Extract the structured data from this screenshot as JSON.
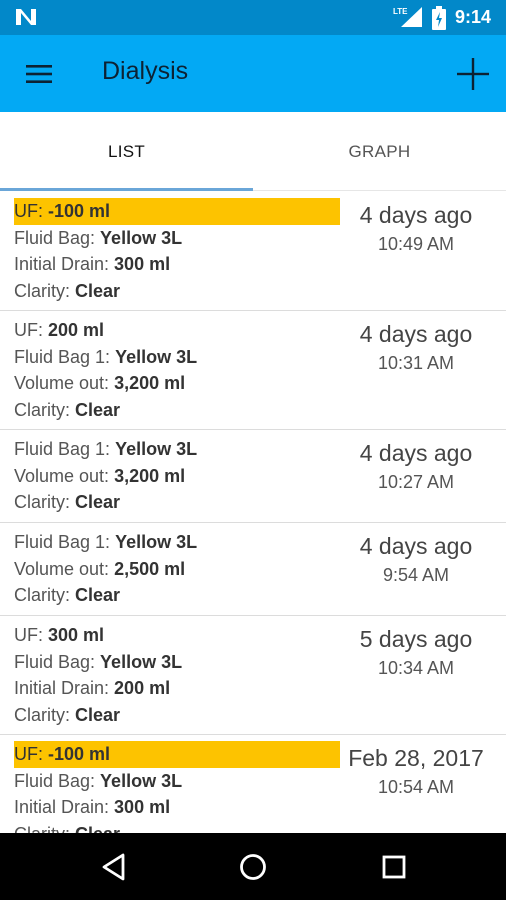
{
  "status_bar": {
    "time": "9:14",
    "network": "LTE",
    "icons": [
      "n-logo-icon",
      "lte-signal-icon",
      "battery-icon"
    ]
  },
  "app_bar": {
    "title": "Dialysis",
    "menu_icon": "hamburger-menu-icon",
    "add_icon": "plus-icon",
    "color": "#03a9f4"
  },
  "tabs": [
    {
      "label": "LIST",
      "selected": true
    },
    {
      "label": "GRAPH",
      "selected": false
    }
  ],
  "highlight_color": "#fdc300",
  "entries": [
    {
      "lines": [
        {
          "label": "UF: ",
          "value": "-100 ml",
          "highlight": true
        },
        {
          "label": "Fluid Bag: ",
          "value": "Yellow 3L",
          "highlight": false
        },
        {
          "label": "Initial Drain: ",
          "value": "300 ml",
          "highlight": false
        },
        {
          "label": "Clarity: ",
          "value": "Clear",
          "highlight": false
        }
      ],
      "day": "4 days ago",
      "time": "10:49 AM"
    },
    {
      "lines": [
        {
          "label": "UF: ",
          "value": "200 ml",
          "highlight": false
        },
        {
          "label": "Fluid Bag 1: ",
          "value": "Yellow 3L",
          "highlight": false
        },
        {
          "label": "Volume out: ",
          "value": "3,200 ml",
          "highlight": false
        },
        {
          "label": "Clarity: ",
          "value": "Clear",
          "highlight": false
        }
      ],
      "day": "4 days ago",
      "time": "10:31 AM"
    },
    {
      "lines": [
        {
          "label": "Fluid Bag 1: ",
          "value": "Yellow 3L",
          "highlight": false
        },
        {
          "label": "Volume out: ",
          "value": "3,200 ml",
          "highlight": false
        },
        {
          "label": "Clarity: ",
          "value": "Clear",
          "highlight": false
        }
      ],
      "day": "4 days ago",
      "time": "10:27 AM"
    },
    {
      "lines": [
        {
          "label": "Fluid Bag 1: ",
          "value": "Yellow 3L",
          "highlight": false
        },
        {
          "label": "Volume out: ",
          "value": "2,500 ml",
          "highlight": false
        },
        {
          "label": "Clarity: ",
          "value": "Clear",
          "highlight": false
        }
      ],
      "day": "4 days ago",
      "time": "9:54 AM"
    },
    {
      "lines": [
        {
          "label": "UF: ",
          "value": "300 ml",
          "highlight": false
        },
        {
          "label": "Fluid Bag: ",
          "value": "Yellow 3L",
          "highlight": false
        },
        {
          "label": "Initial Drain: ",
          "value": "200 ml",
          "highlight": false
        },
        {
          "label": "Clarity: ",
          "value": "Clear",
          "highlight": false
        }
      ],
      "day": "5 days ago",
      "time": "10:34 AM"
    },
    {
      "lines": [
        {
          "label": "UF: ",
          "value": "-100 ml",
          "highlight": true
        },
        {
          "label": "Fluid Bag: ",
          "value": "Yellow 3L",
          "highlight": false
        },
        {
          "label": "Initial Drain: ",
          "value": "300 ml",
          "highlight": false
        },
        {
          "label": "Clarity: ",
          "value": "Clear",
          "highlight": false
        }
      ],
      "day": "Feb 28, 2017",
      "time": "10:54 AM"
    }
  ],
  "nav_bar": {
    "icons": [
      "back-icon",
      "home-icon",
      "recents-icon"
    ]
  }
}
